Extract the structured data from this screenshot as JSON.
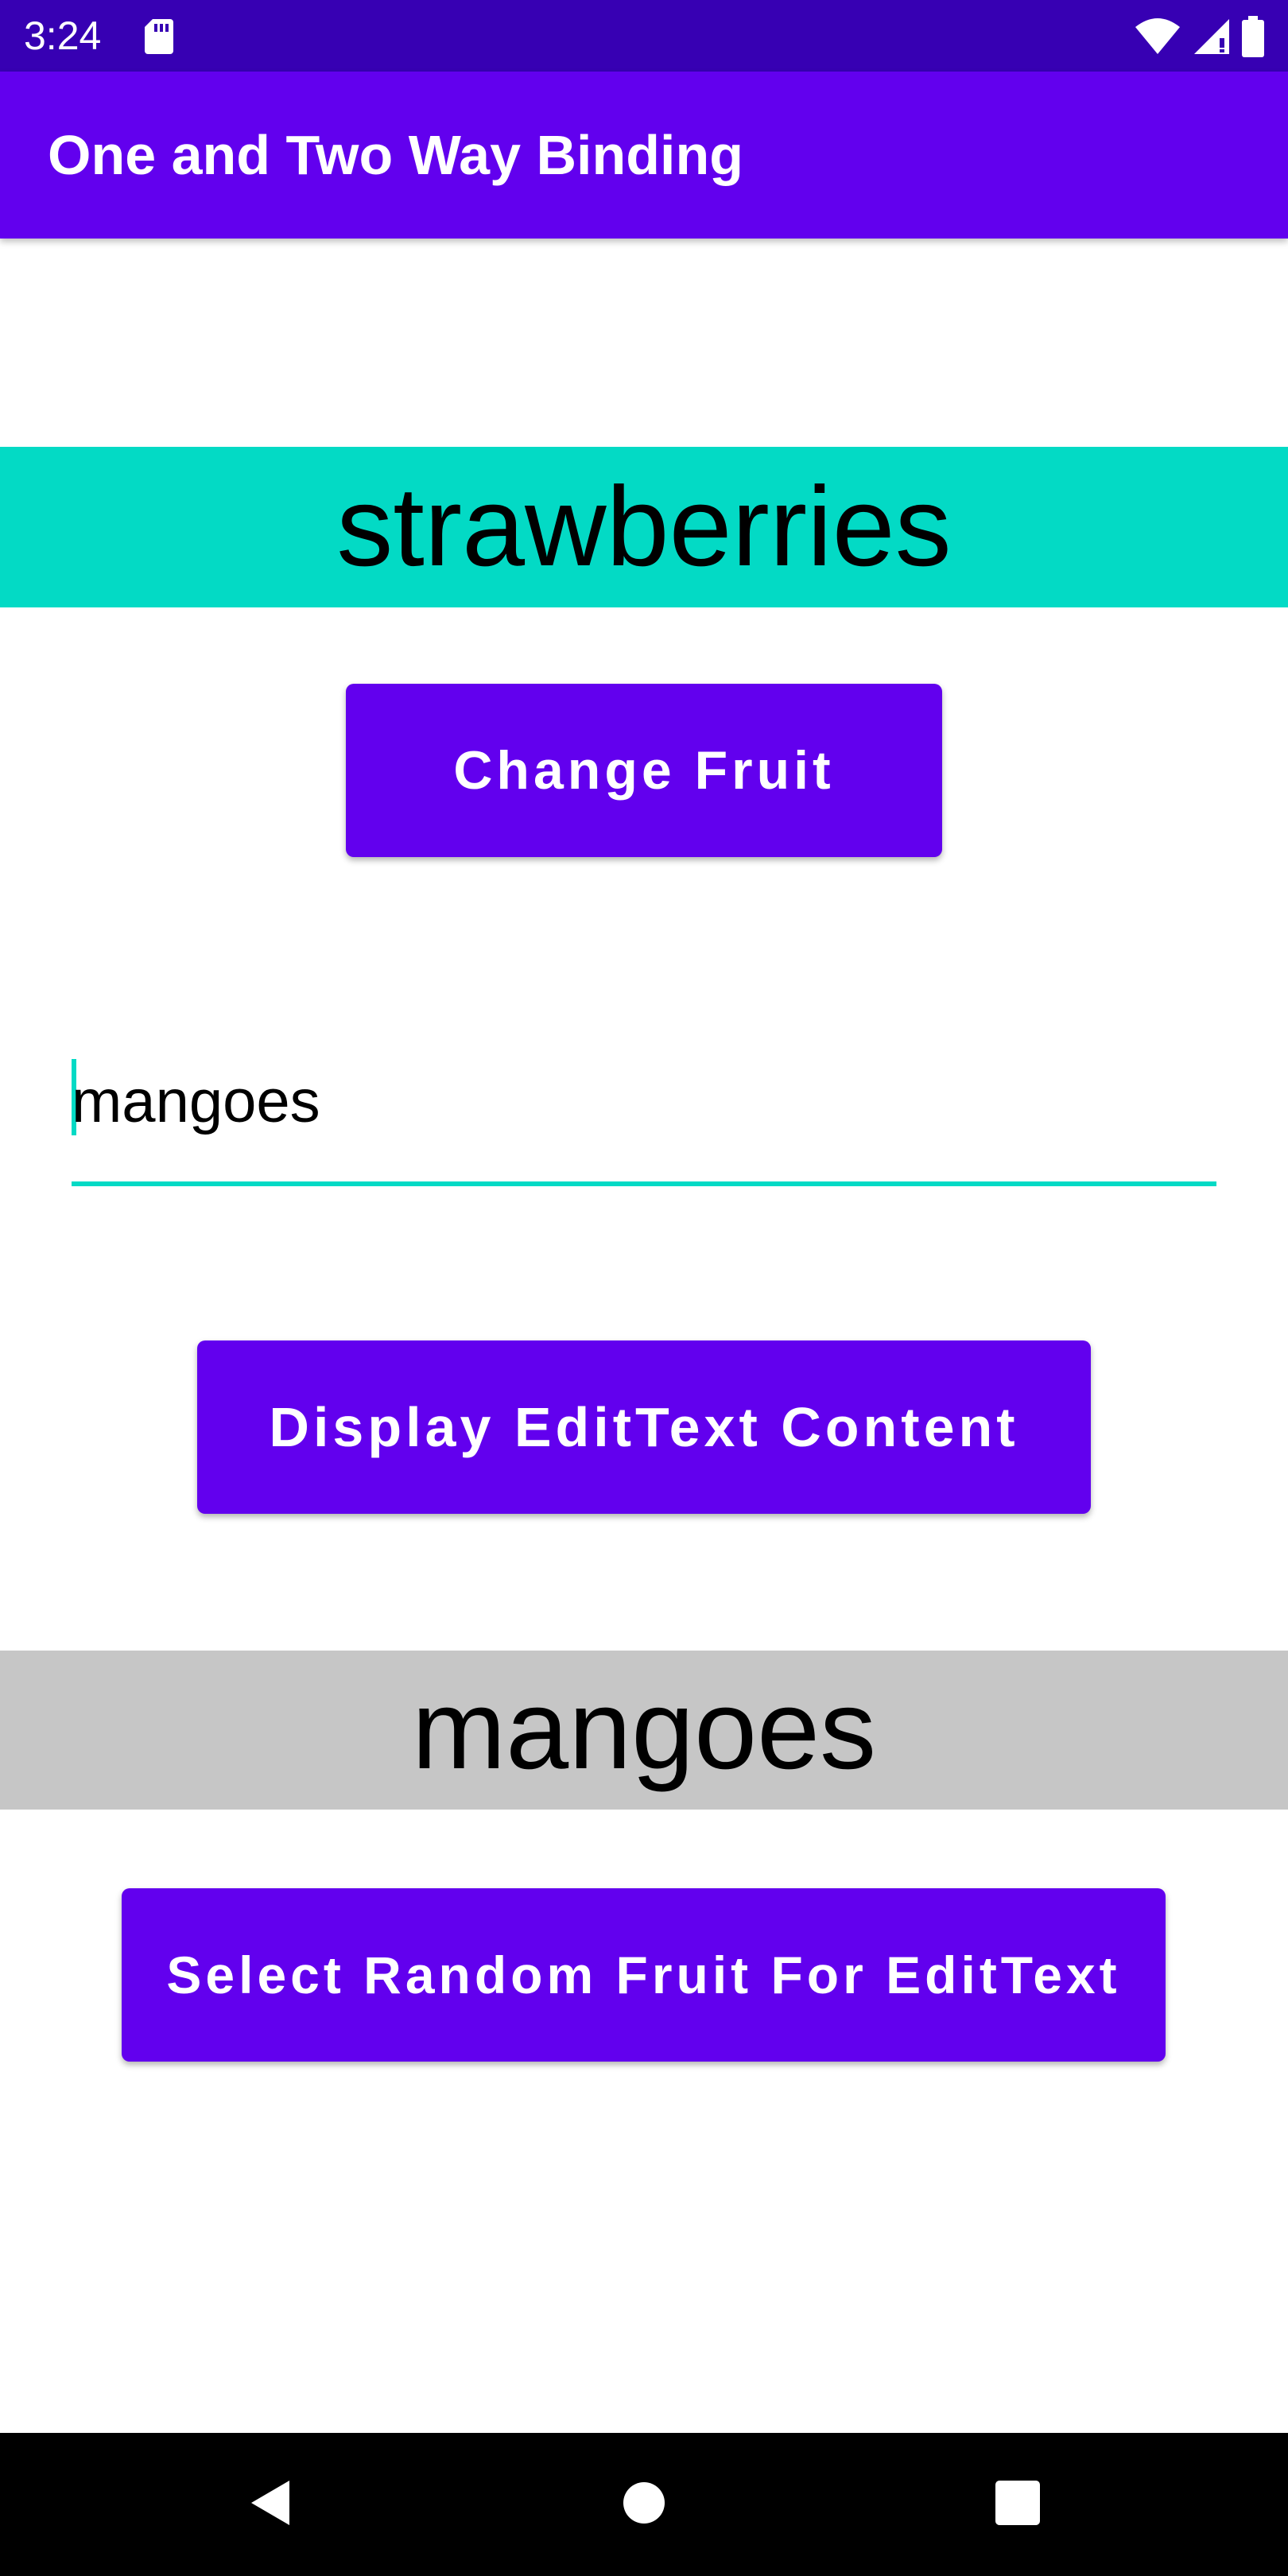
{
  "status_bar": {
    "time": "3:24",
    "icons": [
      "sd-card-icon",
      "wifi-icon",
      "signal-icon",
      "battery-icon"
    ]
  },
  "app_bar": {
    "title": "One and Two Way Binding"
  },
  "fruit_banner": {
    "text": "strawberries",
    "color": "#03dac5"
  },
  "buttons": {
    "change_fruit": "Change Fruit",
    "display_content": "Display EditText Content",
    "select_random": "Select Random Fruit For EditText"
  },
  "edit_text": {
    "value": "mangoes"
  },
  "result_banner": {
    "text": "mangoes",
    "color": "#c6c6c6"
  },
  "colors": {
    "primary": "#6200ee",
    "primary_dark": "#3700b3",
    "accent": "#03dac5"
  },
  "nav_bar": {
    "icons": [
      "back-icon",
      "home-icon",
      "recents-icon"
    ]
  }
}
